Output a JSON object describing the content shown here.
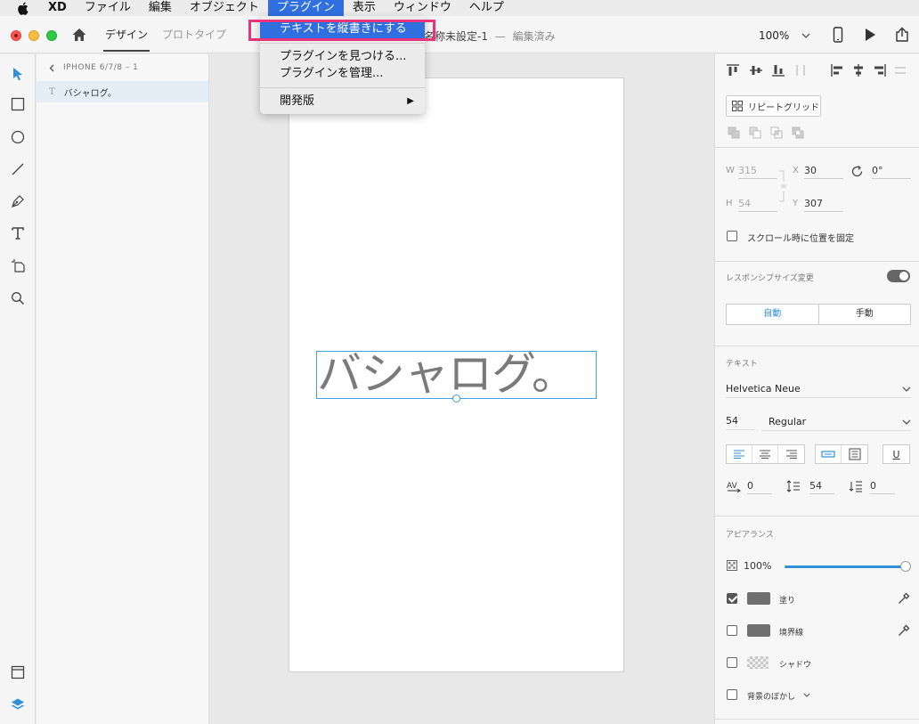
{
  "menubar": {
    "app": "XD",
    "items": [
      "ファイル",
      "編集",
      "オブジェクト",
      "プラグイン",
      "表示",
      "ウィンドウ",
      "ヘルプ"
    ],
    "active": "プラグイン"
  },
  "titlebar": {
    "tab_design": "デザイン",
    "tab_prototype": "プロトタイプ",
    "doc_name": "名称未設定-1",
    "doc_sep": "—",
    "doc_status": "編集済み",
    "zoom": "100%"
  },
  "plugin_menu": {
    "item_vertical": "テキストを縦書きにする",
    "item_find": "プラグインを見つける...",
    "item_manage": "プラグインを管理...",
    "item_dev": "開発版"
  },
  "layers": {
    "breadcrumb": "IPHONE 6/7/8 – 1",
    "layer_name": "バシャログ。"
  },
  "canvas": {
    "text": "バシャログ。"
  },
  "inspector": {
    "repeat_grid": "リピートグリッド",
    "w_label": "W",
    "w_value": "315",
    "h_label": "H",
    "h_value": "54",
    "x_label": "X",
    "x_value": "30",
    "y_label": "Y",
    "y_value": "307",
    "rotation": "0°",
    "fix_scroll": "スクロール時に位置を固定",
    "responsive": "レスポンシブサイズ変更",
    "auto": "自動",
    "manual": "手動",
    "text_title": "テキスト",
    "font": "Helvetica Neue",
    "font_size": "54",
    "font_weight": "Regular",
    "underline": "U",
    "char_spacing": "0",
    "line_spacing": "54",
    "para_spacing": "0",
    "appearance_title": "アピアランス",
    "opacity": "100%",
    "opacity_fraction": 1.0,
    "fill": "塗り",
    "border": "境界線",
    "shadow": "シャドウ",
    "bg_blur": "背景のぼかし",
    "fill_color": "#707070",
    "accent_color": "#2f8fd8"
  }
}
